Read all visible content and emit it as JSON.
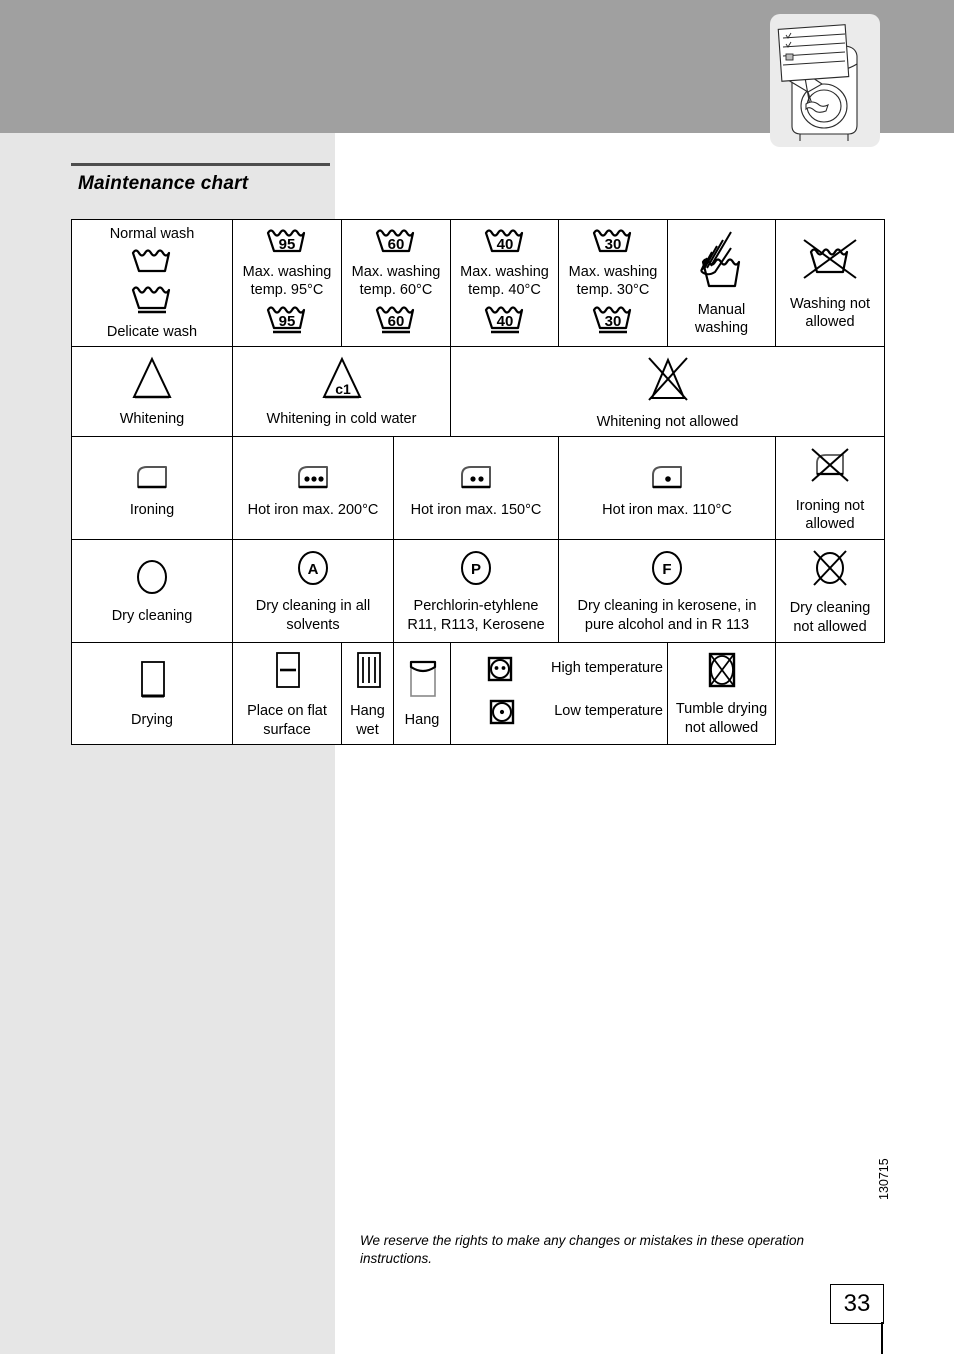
{
  "page": {
    "heading": "Maintenance chart",
    "number": "33",
    "code": "130715",
    "disclaimer": "We reserve the rights to make any changes or mistakes in these operation instructions.",
    "illustration_name": "washing-machine-with-care-label"
  },
  "colors": {
    "top_band": "#a0a0a0",
    "left_tint": "#e6e6e6",
    "illustration_card": "#ebebeb",
    "rule": "#4d4d4d",
    "border": "#000000"
  },
  "chart": {
    "rows": [
      {
        "name": "washing",
        "cells": [
          {
            "label_top": "Normal wash",
            "label_bottom": "Delicate wash",
            "symbols": [
              "wash-tub-icon",
              "wash-tub-underline-icon"
            ]
          },
          {
            "label": "Max. washing temp. 95°C",
            "symbols": [
              "wash-tub-95-icon",
              "wash-tub-95-underline-icon"
            ]
          },
          {
            "label": "Max. washing temp. 60°C",
            "symbols": [
              "wash-tub-60-icon",
              "wash-tub-60-underline-icon"
            ]
          },
          {
            "label": "Max. washing temp. 40°C",
            "symbols": [
              "wash-tub-40-icon",
              "wash-tub-40-underline-icon"
            ]
          },
          {
            "label": "Max. washing temp. 30°C",
            "symbols": [
              "wash-tub-30-icon",
              "wash-tub-30-underline-icon"
            ]
          },
          {
            "label": "Manual washing",
            "symbols": [
              "hand-wash-icon"
            ]
          },
          {
            "label": "Washing not allowed",
            "symbols": [
              "wash-tub-crossed-icon"
            ]
          }
        ]
      },
      {
        "name": "whitening",
        "cells": [
          {
            "label": "Whitening",
            "symbols": [
              "triangle-icon"
            ]
          },
          {
            "label": "Whitening in cold water",
            "symbols": [
              "triangle-c1-icon"
            ]
          },
          {
            "label": "Whitening not allowed",
            "symbols": [
              "triangle-crossed-icon"
            ]
          }
        ]
      },
      {
        "name": "ironing",
        "cells": [
          {
            "label": "Ironing",
            "symbols": [
              "iron-icon"
            ]
          },
          {
            "label": "Hot iron max. 200°C",
            "symbols": [
              "iron-3dots-icon"
            ]
          },
          {
            "label": "Hot iron max. 150°C",
            "symbols": [
              "iron-2dots-icon"
            ]
          },
          {
            "label": "Hot iron max. 110°C",
            "symbols": [
              "iron-1dot-icon"
            ]
          },
          {
            "label": "Ironing not allowed",
            "symbols": [
              "iron-crossed-icon"
            ]
          }
        ]
      },
      {
        "name": "dry-cleaning",
        "cells": [
          {
            "label": "Dry cleaning",
            "symbols": [
              "circle-icon"
            ]
          },
          {
            "label": "Dry cleaning in all solvents",
            "symbols": [
              "circle-a-icon"
            ]
          },
          {
            "label": "Perchlorin-etyhlene R11, R113, Kerosene",
            "symbols": [
              "circle-p-icon"
            ]
          },
          {
            "label": "Dry cleaning in kerosene, in pure alcohol and in R 113",
            "symbols": [
              "circle-f-icon"
            ]
          },
          {
            "label": "Dry cleaning not allowed",
            "symbols": [
              "circle-crossed-icon"
            ]
          }
        ]
      },
      {
        "name": "drying",
        "cells": [
          {
            "label": "Drying",
            "symbols": [
              "square-drying-icon"
            ]
          },
          {
            "label": "Place on flat surface",
            "symbols": [
              "square-flat-dry-icon"
            ]
          },
          {
            "label": "Hang wet",
            "symbols": [
              "square-drip-dry-icon"
            ]
          },
          {
            "label": "Hang",
            "symbols": [
              "square-line-dry-icon"
            ]
          },
          {
            "label_high": "High temperature",
            "label_low": "Low temperature",
            "symbols": [
              "tumble-dry-high-icon",
              "tumble-dry-low-icon"
            ]
          },
          {
            "label": "Tumble drying not allowed",
            "symbols": [
              "tumble-dry-crossed-icon"
            ]
          }
        ]
      }
    ]
  }
}
